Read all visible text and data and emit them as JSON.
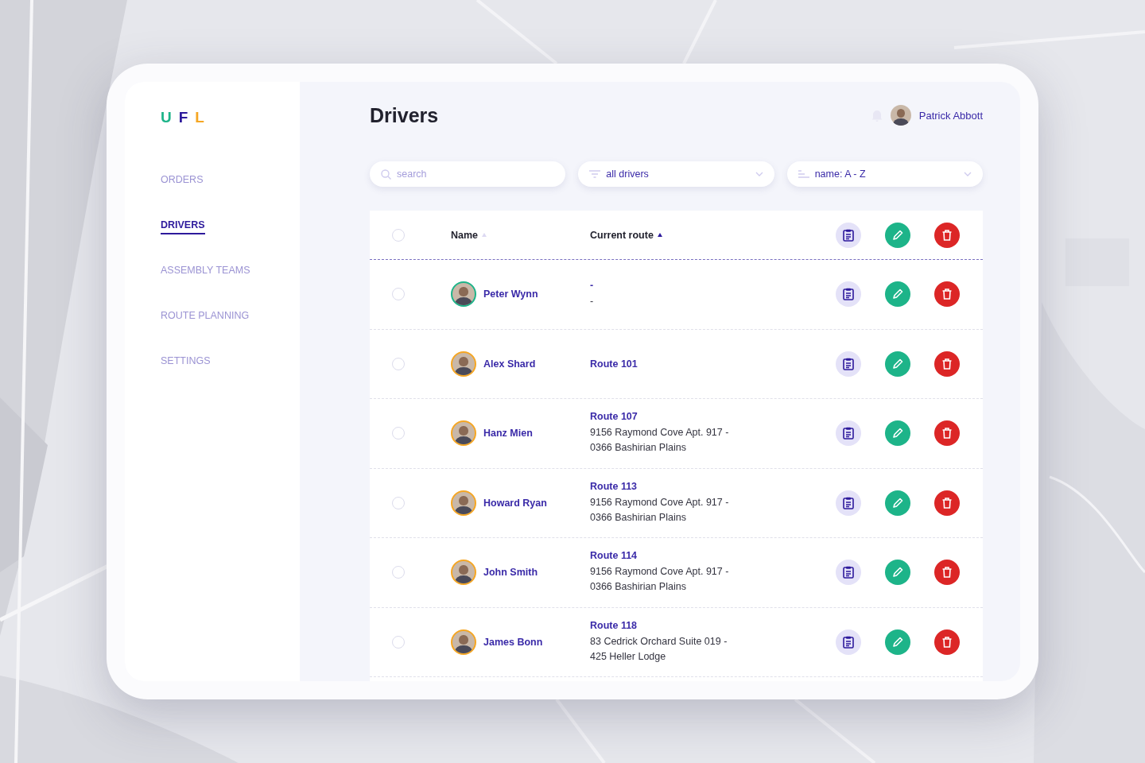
{
  "logo": {
    "letters": [
      {
        "text": "U",
        "color": "#1db489"
      },
      {
        "text": "F",
        "color": "#2d1a9c"
      },
      {
        "text": "L",
        "color": "#f5a623"
      }
    ]
  },
  "sidebar": {
    "items": [
      {
        "label": "ORDERS",
        "selected": false
      },
      {
        "label": "DRIVERS",
        "selected": true
      },
      {
        "label": "ASSEMBLY TEAMS",
        "selected": false
      },
      {
        "label": "ROUTE PLANNING",
        "selected": false
      },
      {
        "label": "SETTINGS",
        "selected": false
      }
    ]
  },
  "header": {
    "title": "Drivers",
    "user": "Patrick Abbott"
  },
  "filters": {
    "search": {
      "placeholder": "search"
    },
    "status": "all drivers",
    "sort": "name: A - Z"
  },
  "table": {
    "header_checked": false,
    "columns": [
      {
        "label": "Name",
        "sorted": false
      },
      {
        "label": "Current route",
        "sorted": true
      }
    ],
    "rows": [
      {
        "name": "Peter Wynn",
        "color": "#1db489",
        "route": "-",
        "address": "-",
        "checked": false
      },
      {
        "name": "Alex Shard",
        "color": "#f5a623",
        "route": "Route 101",
        "checked": false
      },
      {
        "name": "Hanz Mien",
        "color": "#f5a623",
        "route": "Route 107",
        "address": "9156 Raymond Cove Apt. 917 - 0366 Bashirian Plains",
        "checked": false
      },
      {
        "name": "Howard Ryan",
        "color": "#f5a623",
        "route": "Route 113",
        "address": "9156 Raymond Cove Apt. 917 - 0366 Bashirian Plains",
        "checked": false
      },
      {
        "name": "John Smith",
        "color": "#f5a623",
        "route": "Route 114",
        "address": "9156 Raymond Cove Apt. 917 - 0366 Bashirian Plains",
        "checked": false
      },
      {
        "name": "James Bonn",
        "color": "#f5a623",
        "route": "Route 118",
        "address": "83 Cedrick Orchard Suite 019 - 425 Heller Lodge",
        "checked": false
      }
    ]
  }
}
